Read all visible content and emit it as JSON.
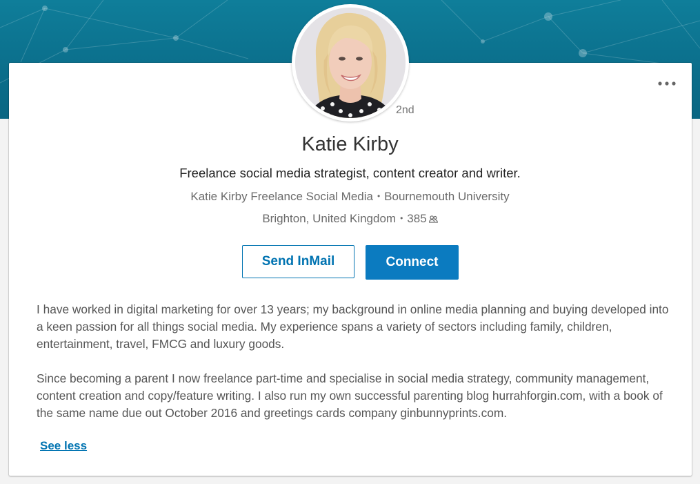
{
  "profile": {
    "degree": "2nd",
    "name": "Katie Kirby",
    "headline": "Freelance social media strategist, content creator and writer.",
    "company": "Katie Kirby Freelance Social Media",
    "school": "Bournemouth University",
    "location": "Brighton, United Kingdom",
    "connections": "385",
    "separator": "•"
  },
  "actions": {
    "inmail_label": "Send InMail",
    "connect_label": "Connect"
  },
  "summary": {
    "paragraph1": "I have worked in digital marketing for over 13 years; my background in online media planning and buying developed into a keen passion for all things social media. My experience spans a variety of sectors including family, children, entertainment, travel, FMCG and luxury goods.",
    "paragraph2": "Since becoming a parent I now freelance part-time and specialise in social media strategy, community management, content creation and copy/feature writing. I also run my own successful parenting blog hurrahforgin.com, with a book of the same name due out October 2016 and greetings cards company ginbunnyprints.com.",
    "see_less": "See less"
  },
  "icons": {
    "more": "more-options-icon",
    "connections": "connections-icon"
  },
  "colors": {
    "accent": "#0073b1",
    "connect_bg": "#0b7bc0",
    "banner": "#0b6e8b"
  }
}
